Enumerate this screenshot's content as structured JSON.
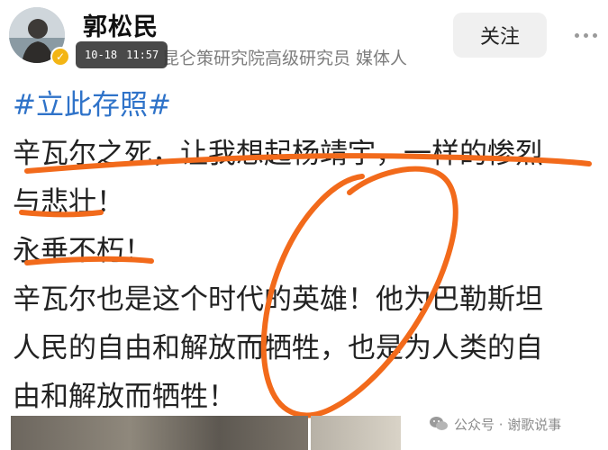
{
  "header": {
    "username": "郭松民",
    "time_chip": {
      "date": "10-18",
      "time": "11:57"
    },
    "bio_hidden": "昆仑策研究",
    "bio": "昆仑策研究院高级研究员 媒体人",
    "follow_label": "关注"
  },
  "post": {
    "hashtag": "#立此存照#",
    "lines": [
      "辛瓦尔之死，让我想起杨靖宇，一样的惨烈",
      "与悲壮！",
      "永垂不朽！",
      "辛瓦尔也是这个时代的英雄！他为巴勒斯坦",
      "人民的自由和解放而牺牲，也是为人类的自",
      "由和解放而牺牲！"
    ]
  },
  "watermark": {
    "label": "公众号 · 谢歌说事"
  },
  "colors": {
    "hashtag": "#2f73c9",
    "annotation_orange": "#f26a1b",
    "badge": "#f3b515"
  }
}
